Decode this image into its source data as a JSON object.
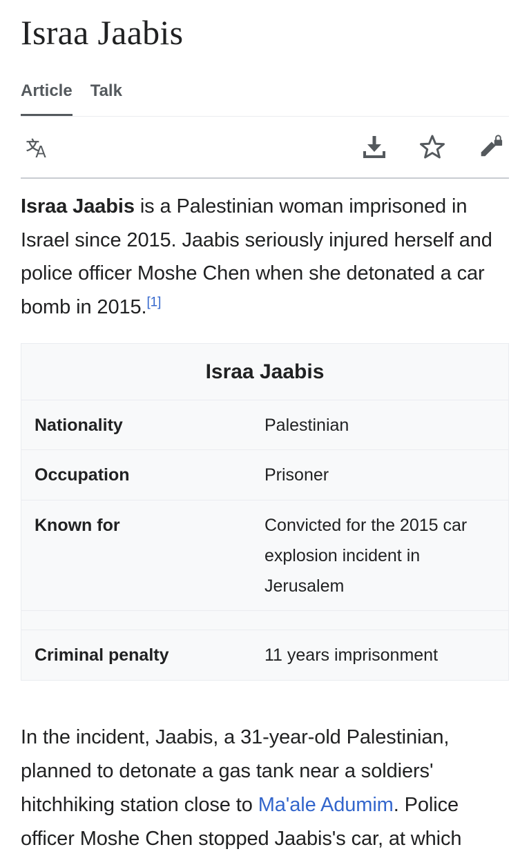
{
  "article": {
    "title": "Israa Jaabis",
    "tabs": [
      {
        "label": "Article",
        "active": true
      },
      {
        "label": "Talk",
        "active": false
      }
    ]
  },
  "toolbar": {
    "icons": [
      "language-icon",
      "download-icon",
      "watch-star-icon",
      "edit-locked-icon"
    ]
  },
  "lead": {
    "subject": "Israa Jaabis",
    "text": " is a Palestinian woman imprisoned in Israel since 2015. Jaabis seriously injured herself and police officer Moshe Chen when she detonated a car bomb in 2015.",
    "ref": "[1]"
  },
  "infobox": {
    "title": "Israa Jaabis",
    "rows": [
      {
        "label": "Nationality",
        "value": "Palestinian"
      },
      {
        "label": "Occupation",
        "value": "Prisoner"
      },
      {
        "label": "Known for",
        "value": "Convicted for the 2015 car explosion incident in Jerusalem"
      },
      {
        "label": "Criminal penalty",
        "value": "11 years imprisonment"
      }
    ]
  },
  "body": {
    "para_before_link": "In the incident, Jaabis, a 31-year-old Palestinian, planned to detonate a gas tank near a soldiers' hitchhiking station close to ",
    "link_text": "Ma'ale Adumim",
    "para_after_link": ". Police officer Moshe Chen stopped Jaabis's car, at which"
  },
  "colors": {
    "link": "#3366cc",
    "text": "#202122",
    "infobox_bg": "#f8f9fa"
  }
}
